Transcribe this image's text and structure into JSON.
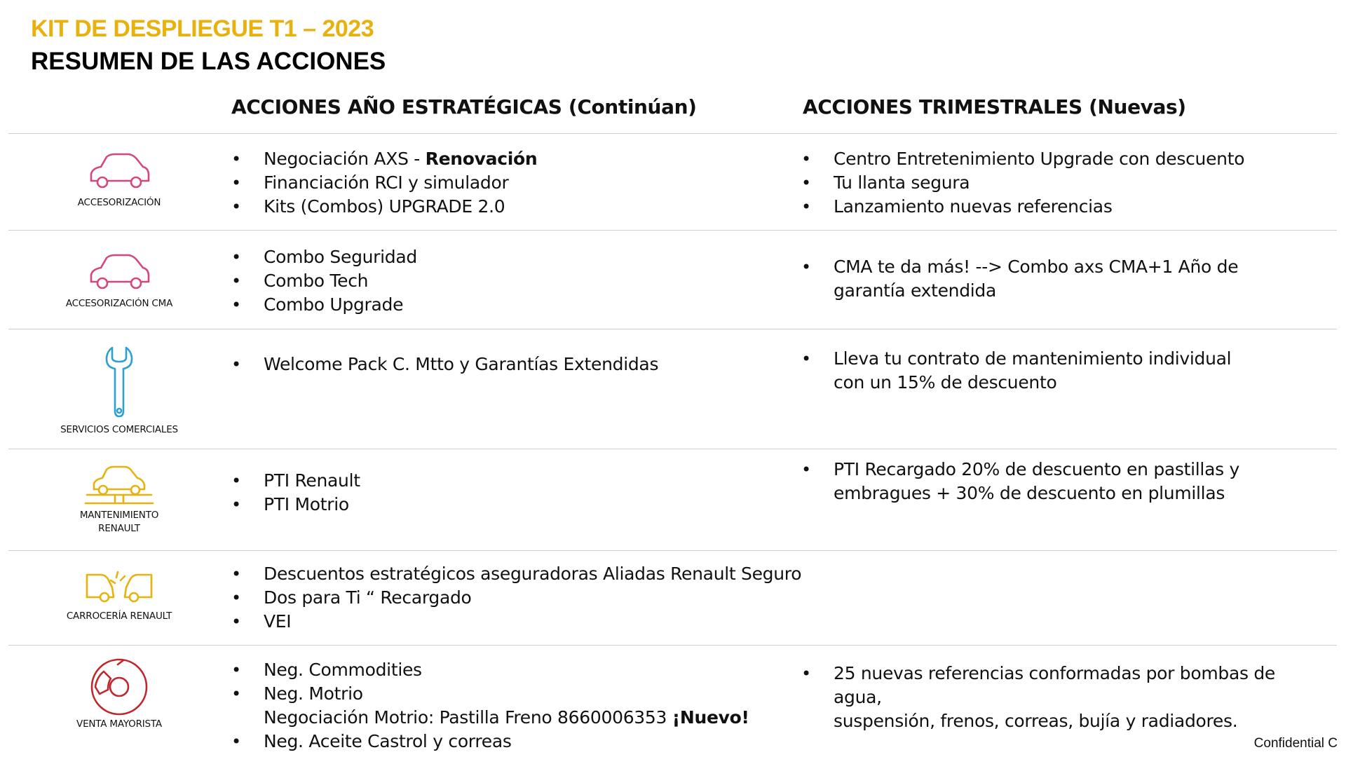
{
  "header": {
    "kicker": "KIT DE DESPLIEGUE T1 – 2023",
    "title": "RESUMEN DE LAS ACCIONES"
  },
  "columns": {
    "left": "ACCIONES AÑO ESTRATÉGICAS (Continúan)",
    "right": "ACCIONES TRIMESTRALES (Nuevas)"
  },
  "colors": {
    "accent_yellow": "#E8B20E",
    "pink_icon": "#D6457E",
    "blue_icon": "#2C9FD3",
    "red_icon": "#C0262D"
  },
  "rows": [
    {
      "icon": "car-icon",
      "label": "ACCESORIZACIÓN",
      "left": [
        {
          "text": "Negociación AXS  - ",
          "bold": "Renovación"
        },
        {
          "text": "Financiación RCI y simulador"
        },
        {
          "text": "Kits (Combos) UPGRADE 2.0"
        }
      ],
      "right": [
        {
          "text": "Centro Entretenimiento Upgrade con descuento"
        },
        {
          "text": "Tu llanta segura"
        },
        {
          "text": "Lanzamiento nuevas referencias"
        }
      ]
    },
    {
      "icon": "car-icon",
      "label": "ACCESORIZACIÓN CMA",
      "left": [
        {
          "text": "Combo Seguridad"
        },
        {
          "text": "Combo Tech"
        },
        {
          "text": "Combo Upgrade"
        }
      ],
      "right": [
        {
          "line1": "CMA te da más! --> Combo axs CMA+1 Año de",
          "line2": "garantía extendida"
        }
      ]
    },
    {
      "icon": "wrench-icon",
      "label": "SERVICIOS COMERCIALES",
      "left": [
        {
          "text": "Welcome Pack C. Mtto y Garantías Extendidas"
        }
      ],
      "right": [
        {
          "line1": "Lleva tu contrato de mantenimiento individual",
          "line2": "con un 15% de descuento"
        }
      ]
    },
    {
      "icon": "car-lift-icon",
      "label_line1": "MANTENIMIENTO",
      "label_line2": "RENAULT",
      "left": [
        {
          "text": "PTI Renault"
        },
        {
          "text": "PTI Motrio"
        }
      ],
      "right": [
        {
          "line1": "PTI Recargado 20% de descuento en pastillas y",
          "line2": "embragues + 30% de descuento en plumillas"
        }
      ]
    },
    {
      "icon": "car-crash-icon",
      "label": "CARROCERÍA RENAULT",
      "left": [
        {
          "text": "Descuentos estratégicos aseguradoras Aliadas Renault Seguro"
        },
        {
          "text": "Dos para Ti “ Recargado"
        },
        {
          "text": "VEI"
        }
      ],
      "right": []
    },
    {
      "icon": "brake-disc-icon",
      "label": "VENTA MAYORISTA",
      "left": [
        {
          "text": "Neg. Commodities"
        },
        {
          "text": "Neg. Motrio"
        },
        {
          "cont": "Negociación Motrio: Pastilla Freno 8660006353 ",
          "bold": "¡Nuevo!"
        },
        {
          "text": "Neg. Aceite Castrol y correas"
        }
      ],
      "right": [
        {
          "line1": "25 nuevas referencias conformadas por  bombas de agua,",
          "line2": "suspensión, frenos, correas, bujía y radiadores."
        }
      ]
    }
  ],
  "footer": "Confidential C"
}
